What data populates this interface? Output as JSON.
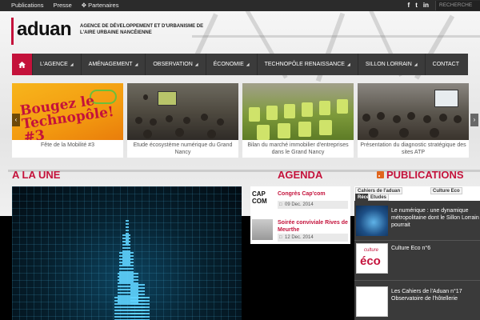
{
  "topbar": {
    "links": [
      "Publications",
      "Presse",
      "Partenaires"
    ],
    "social": [
      "f",
      "t",
      "in"
    ],
    "search_placeholder": "RECHERCHE"
  },
  "header": {
    "logo": "aduan",
    "tagline": "Agence de développement et d'urbanisme de l'aire urbaine nancéienne"
  },
  "nav": {
    "items": [
      "L'AGENCE",
      "AMÉNAGEMENT",
      "OBSERVATION",
      "ÉCONOMIE",
      "TECHNOPÔLE RENAISSANCE",
      "SILLON LORRAIN",
      "CONTACT"
    ]
  },
  "slider": {
    "slides": [
      {
        "caption": "Fête de la Mobilité #3",
        "image_text": "Bougez le Technopôle! #3"
      },
      {
        "caption": "Etude écosystème numérique du Grand Nancy"
      },
      {
        "caption": "Bilan du marché immobilier d'entreprises dans le Grand Nancy"
      },
      {
        "caption": "Présentation du diagnostic stratégique des sites ATP"
      }
    ]
  },
  "sections": {
    "une": "A LA UNE",
    "agenda": "AGENDA",
    "publications": "PUBLICATIONS"
  },
  "agenda": {
    "items": [
      {
        "thumb": "CAP COM",
        "title": "Congrès Cap'com",
        "date": "09 Dec. 2014"
      },
      {
        "title": "Soirée conviviale Rives de Meurthe",
        "date": "12 Dec. 2014"
      }
    ]
  },
  "publications": {
    "tabs": [
      "Récentes",
      "Cahiers de l'aduan",
      "Culture Eco",
      "Etudes"
    ],
    "items": [
      {
        "title": "Le numérique : une dynamique métropolitaine dont le Sillon Lorrain pourrait"
      },
      {
        "title": "Culture Eco n°6",
        "thumb_top": "culture",
        "thumb_main": "éco"
      },
      {
        "title": "Les Cahiers de l'Aduan n°17 Observatoire de l'hôtellerie"
      }
    ]
  },
  "colors": {
    "accent": "#c4123b",
    "nav_bg": "#3b3b3b",
    "topbar_bg": "#2b2b2b"
  }
}
